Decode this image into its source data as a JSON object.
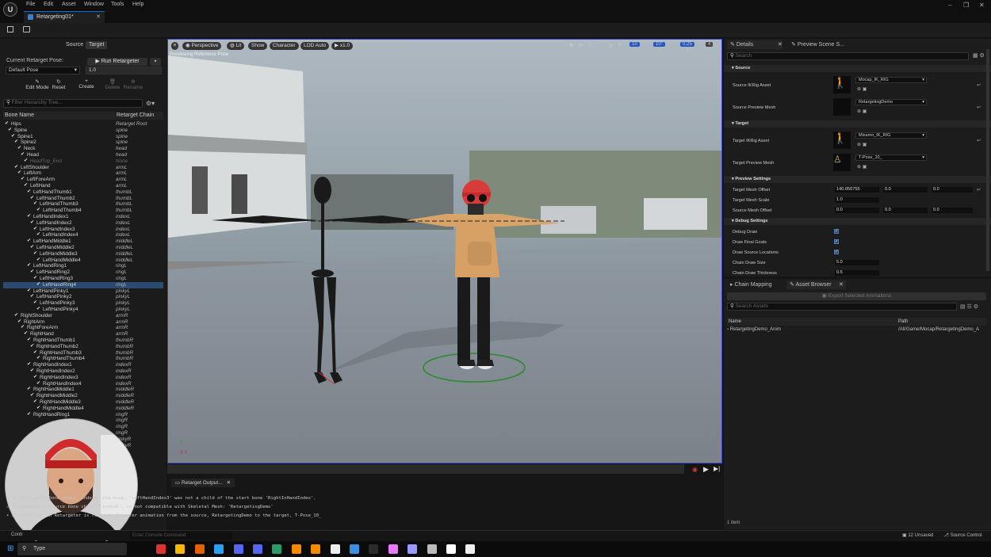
{
  "app": {
    "menu": [
      "File",
      "Edit",
      "Asset",
      "Window",
      "Tools",
      "Help"
    ],
    "doc_tab": "Retargeting01*",
    "logo": "U"
  },
  "left": {
    "tabs": [
      "Source",
      "Target"
    ],
    "retarget_pose_label": "Current Retarget Pose:",
    "run_retarget": "Run Retargeter",
    "pose_value": "Default Pose",
    "pose_blend": "1.0",
    "tools": [
      "Edit Mode",
      "Reset",
      "Create",
      "Delete",
      "Rename"
    ],
    "filter_placeholder": "Filter Hierarchy Tree...",
    "col_bone": "Bone Name",
    "col_chain": "Retarget Chain",
    "rows": [
      {
        "b": "Hips",
        "c": "Retarget Root"
      },
      {
        "b": "Spine",
        "c": "spine"
      },
      {
        "b": "Spine1",
        "c": "spine"
      },
      {
        "b": "Spine2",
        "c": "spine"
      },
      {
        "b": "Neck",
        "c": "head"
      },
      {
        "b": "Head",
        "c": "head"
      },
      {
        "b": "HeadTop_End",
        "c": "None"
      },
      {
        "b": "LeftShoulder",
        "c": "armL"
      },
      {
        "b": "LeftArm",
        "c": "armL"
      },
      {
        "b": "LeftForeArm",
        "c": "armL"
      },
      {
        "b": "LeftHand",
        "c": "armL"
      },
      {
        "b": "LeftHandThumb1",
        "c": "thumbL"
      },
      {
        "b": "LeftHandThumb2",
        "c": "thumbL"
      },
      {
        "b": "LeftHandThumb3",
        "c": "thumbL"
      },
      {
        "b": "LeftHandThumb4",
        "c": "thumbL"
      },
      {
        "b": "LeftHandIndex1",
        "c": "indexL"
      },
      {
        "b": "LeftHandIndex2",
        "c": "indexL"
      },
      {
        "b": "LeftHandIndex3",
        "c": "indexL"
      },
      {
        "b": "LeftHandIndex4",
        "c": "indexL"
      },
      {
        "b": "LeftHandMiddle1",
        "c": "middleL"
      },
      {
        "b": "LeftHandMiddle2",
        "c": "middleL"
      },
      {
        "b": "LeftHandMiddle3",
        "c": "middleL"
      },
      {
        "b": "LeftHandMiddle4",
        "c": "middleL"
      },
      {
        "b": "LeftHandRing1",
        "c": "ringL"
      },
      {
        "b": "LeftHandRing2",
        "c": "ringL"
      },
      {
        "b": "LeftHandRing3",
        "c": "ringL"
      },
      {
        "b": "LeftHandRing4",
        "c": "ringL"
      },
      {
        "b": "LeftHandPinky1",
        "c": "pinkyL"
      },
      {
        "b": "LeftHandPinky2",
        "c": "pinkyL"
      },
      {
        "b": "LeftHandPinky3",
        "c": "pinkyL"
      },
      {
        "b": "LeftHandPinky4",
        "c": "pinkyL"
      },
      {
        "b": "RightShoulder",
        "c": "armR"
      },
      {
        "b": "RightArm",
        "c": "armR"
      },
      {
        "b": "RightForeArm",
        "c": "armR"
      },
      {
        "b": "RightHand",
        "c": "armR"
      },
      {
        "b": "RightHandThumb1",
        "c": "thumbR"
      },
      {
        "b": "RightHandThumb2",
        "c": "thumbR"
      },
      {
        "b": "RightHandThumb3",
        "c": "thumbR"
      },
      {
        "b": "RightHandThumb4",
        "c": "thumbR"
      },
      {
        "b": "RightHandIndex1",
        "c": "indexR"
      },
      {
        "b": "RightHandIndex2",
        "c": "indexR"
      },
      {
        "b": "RightHandIndex3",
        "c": "indexR"
      },
      {
        "b": "RightHandIndex4",
        "c": "indexR"
      },
      {
        "b": "RightHandMiddle1",
        "c": "middleR"
      },
      {
        "b": "RightHandMiddle2",
        "c": "middleR"
      },
      {
        "b": "RightHandMiddle3",
        "c": "middleR"
      },
      {
        "b": "RightHandMiddle4",
        "c": "middleR"
      },
      {
        "b": "RightHandRing1",
        "c": "ringR"
      },
      {
        "b": "",
        "c": "ringR"
      },
      {
        "b": "",
        "c": "ringR"
      },
      {
        "b": "",
        "c": "ringR"
      },
      {
        "b": "",
        "c": "pinkyR"
      },
      {
        "b": "",
        "c": "pinkyR"
      }
    ],
    "selected_row": "LeftHandRing4"
  },
  "viewport": {
    "buttons": [
      "Perspective",
      "Lit",
      "Show",
      "Character",
      "LOD Auto",
      "x1.0"
    ],
    "status": "Previewing Reference Pose",
    "right_controls": [
      "10",
      "10°",
      "0.25",
      "4"
    ]
  },
  "output": {
    "tab": "Retarget Output...",
    "lines": [
      {
        "icon": "warning",
        "text": "IK Retargeter bone chain, indexR, end bone, 'LeftHandIndex3' was not a child of the start bone 'RightInHandIndex'."
      },
      {
        "icon": "warning",
        "text": "IK Retargeter source bone chain, 'indexR', is not compatible with Skeletal Mesh: 'RetargetingDemo'"
      },
      {
        "icon": "bullet",
        "text": "Success! The IK Retargeter is ready to transfer animation from the source, RetargetingDemo to the target, T-Pose_10_"
      }
    ]
  },
  "details": {
    "tabs": [
      "Details",
      "Preview Scene S..."
    ],
    "search_placeholder": "Search",
    "source_header": "Source",
    "source_ikrig_label": "Source IKRig Asset",
    "source_ikrig_value": "Mocap_IK_RIG",
    "source_mesh_label": "Source Preview Mesh",
    "source_mesh_value": "RetargetingDemo",
    "target_header": "Target",
    "target_ikrig_label": "Target IKRig Asset",
    "target_ikrig_value": "Mixamo_IK_RIG",
    "target_mesh_label": "Target Preview Mesh",
    "target_mesh_value": "T-Pose_10_",
    "preview_header": "Preview Settings",
    "target_mesh_offset_label": "Target Mesh Offset",
    "target_mesh_offset": [
      "140.056755",
      "0.0",
      "0.0"
    ],
    "target_mesh_scale_label": "Target Mesh Scale",
    "target_mesh_scale": "1.0",
    "source_mesh_offset_label": "Source Mesh Offset",
    "source_mesh_offset": [
      "0.0",
      "0.0",
      "0.0"
    ],
    "debug_header": "Debug Settings",
    "debug_draw": "Debug Draw",
    "draw_final_goals": "Draw Final Goals",
    "draw_source_locations": "Draw Source Locations",
    "chain_draw_size_label": "Chain Draw Size",
    "chain_draw_size": "5.0",
    "chain_draw_thickness_label": "Chain Draw Thickness",
    "chain_draw_thickness": "0.5"
  },
  "assets": {
    "tabs": [
      "Chain Mapping",
      "Asset Browser"
    ],
    "export_button": "Export Selected Animations",
    "search_placeholder": "Search Assets",
    "col_name": "Name",
    "col_path": "Path",
    "items": [
      {
        "name": "RetargetingDemo_Anim",
        "path": "/All/Game/Mocap/RetargetingDemo_A"
      }
    ],
    "count": "1 item"
  },
  "status": {
    "console_placeholder": "Enter Console Command",
    "unsaved": "12 Unsaved",
    "source_control": "Source Control"
  },
  "taskbar": {
    "search": "Type",
    "icons": [
      "windows-start",
      "search",
      "task-view",
      "chrome",
      "file-explorer",
      "firefox",
      "chrome-2",
      "discord",
      "discord-2",
      "maps",
      "blender",
      "blender-2",
      "obs",
      "notes",
      "terminal",
      "premiere",
      "after-effects",
      "settings",
      "obs-2",
      "unreal"
    ]
  },
  "colors": {
    "accent": "#0070e0",
    "viewport_border": "#3a45c8",
    "selected": "#2a4a70"
  }
}
